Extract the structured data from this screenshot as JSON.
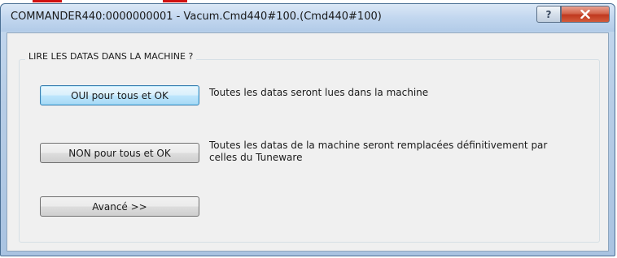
{
  "window": {
    "title": "COMMANDER440:0000000001 - Vacum.Cmd440#100.(Cmd440#100)",
    "help_symbol": "?",
    "close_symbol": "X"
  },
  "group": {
    "legend": "LIRE LES DATAS DANS LA MACHINE ?"
  },
  "options": {
    "yes_button": "OUI pour tous et OK",
    "yes_desc": "Toutes les datas seront lues dans la machine",
    "no_button": "NON pour tous et OK",
    "no_desc_line1": "Toutes les datas de la machine seront remplacées définitivement par",
    "no_desc_line2": "celles du Tuneware",
    "advanced_button": "Avancé >>"
  },
  "colors": {
    "close_button": "#c0391f",
    "default_button_border": "#3c7fb1",
    "client_background": "#f0f0f0"
  },
  "icons": {
    "help": "question-mark-icon",
    "close": "close-x-icon"
  }
}
